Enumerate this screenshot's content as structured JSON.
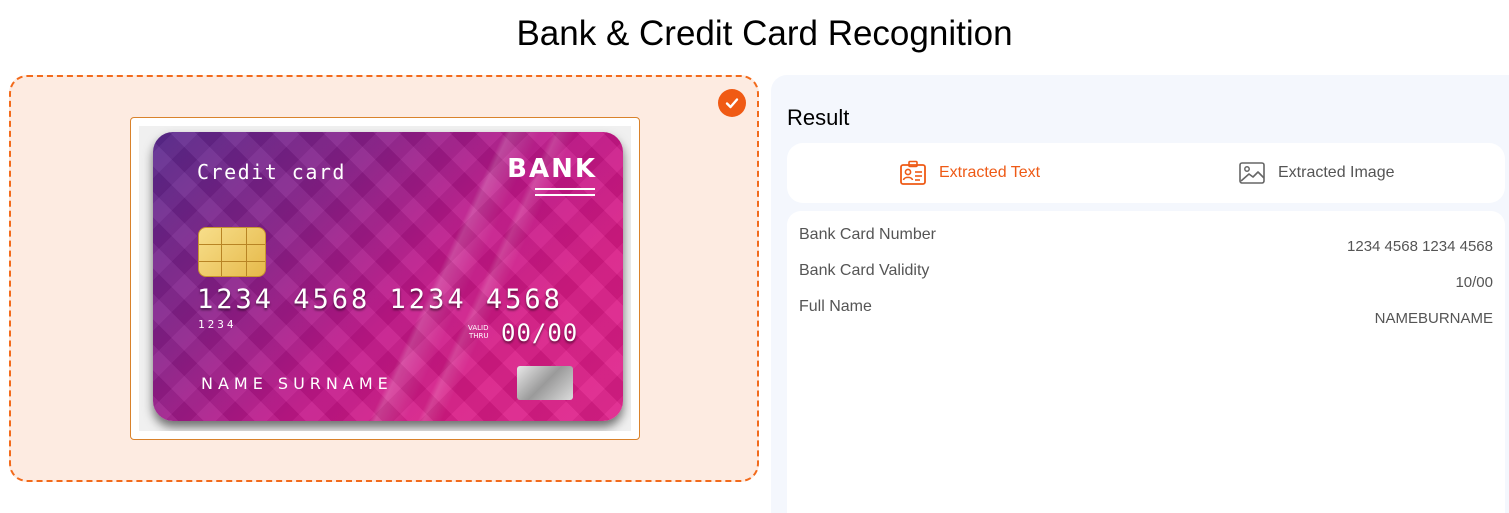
{
  "page": {
    "title": "Bank & Credit Card Recognition"
  },
  "upload": {
    "status": "uploaded",
    "card_image": {
      "card_type": "Credit card",
      "bank": "BANK",
      "number": "1234  4568 1234  4568",
      "number_small": "1234",
      "valid_thru_label_1": "VALID",
      "valid_thru_label_2": "THRU",
      "expiry": "00/00",
      "holder": "NAME SURNAME"
    }
  },
  "result": {
    "heading": "Result",
    "tabs": [
      {
        "label": "Extracted Text",
        "icon": "id-card-icon",
        "active": true
      },
      {
        "label": "Extracted Image",
        "icon": "image-icon",
        "active": false
      }
    ],
    "fields": [
      {
        "label": "Bank Card Number",
        "value": "1234 4568 1234 4568"
      },
      {
        "label": "Bank Card Validity",
        "value": "10/00"
      },
      {
        "label": "Full Name",
        "value": "NAMEBURNAME"
      }
    ]
  },
  "colors": {
    "accent": "#ee5a16",
    "upload_bg": "#fdebe1",
    "result_bg": "#f4f7fd"
  }
}
